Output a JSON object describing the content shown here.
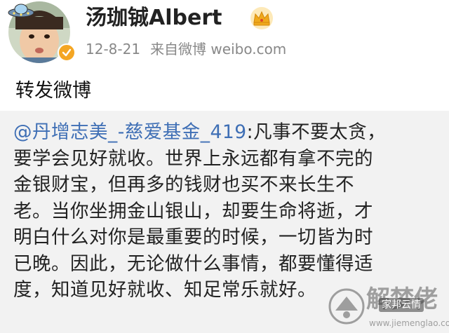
{
  "post": {
    "username": "汤珈铖Albert",
    "date": "12-8-21",
    "source": "来自微博 weibo.com",
    "repost_label": "转发微博",
    "quote": {
      "mention": "@丹增志美_-慈爱基金_419",
      "lines": [
        ":凡事不要太贪，",
        "要学会见好就收。世界上永远都有拿不完的",
        "金银财宝，但再多的钱财也买不来长生不",
        "老。当你坐拥金山银山，却要生命将逝，才",
        "明白什么对你是最重要的时候，一切皆为时",
        "已晚。因此，无论做什么事情，都要懂得适",
        "度，知道见好就收、知足常乐就好。"
      ]
    }
  },
  "watermark": {
    "big_text": "解梦佬",
    "small_text": "www.jiemenglao.com",
    "tag_text": "家邦云情"
  },
  "colors": {
    "mention": "#3f6fb5",
    "quote_background": "#f2f2f2",
    "meta_text": "#888888",
    "verified_badge": "#f4a623",
    "crown": "#f0a91c"
  },
  "icons": {
    "verified": "verified-badge-icon",
    "crown": "crown-icon",
    "ufo": "ufo-icon",
    "watermark_logo": "watermark-logo-icon"
  }
}
